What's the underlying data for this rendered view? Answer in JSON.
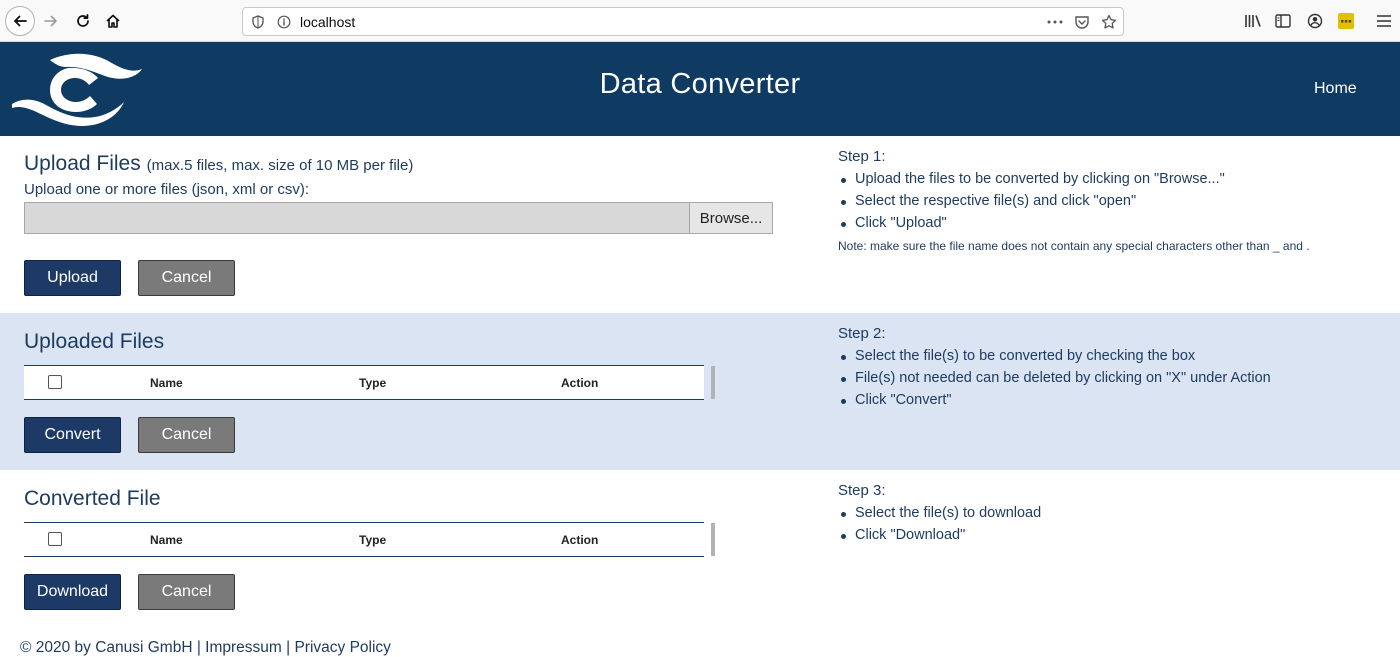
{
  "browser": {
    "url": "localhost",
    "icons": [
      "back-icon",
      "forward-icon",
      "reload-icon",
      "home-icon",
      "shield-icon",
      "info-icon",
      "more-icon",
      "pocket-icon",
      "star-icon",
      "library-icon",
      "sidebar-icon",
      "account-icon",
      "extension-icon",
      "menu-icon"
    ]
  },
  "header": {
    "title": "Data Converter",
    "home_link": "Home",
    "brand_color": "#0f3a62"
  },
  "upload": {
    "title": "Upload Files",
    "title_note": "(max.5 files, max. size of 10 MB per file)",
    "label": "Upload one or more files (json, xml or csv):",
    "browse_label": "Browse...",
    "upload_label": "Upload",
    "cancel_label": "Cancel"
  },
  "uploaded": {
    "title": "Uploaded Files",
    "columns": [
      "Name",
      "Type",
      "Action"
    ],
    "convert_label": "Convert",
    "cancel_label": "Cancel"
  },
  "converted": {
    "title": "Converted File",
    "columns": [
      "Name",
      "Type",
      "Action"
    ],
    "download_label": "Download",
    "cancel_label": "Cancel"
  },
  "steps": [
    {
      "title": "Step 1:",
      "items": [
        "Upload the files to be converted by clicking on \"Browse...\"",
        "Select the respective file(s) and click \"open\"",
        "Click \"Upload\""
      ],
      "note": "Note: make sure the file name does not contain any special characters other than _ and ."
    },
    {
      "title": "Step 2:",
      "items": [
        "Select the file(s) to be converted by checking the box",
        "File(s) not needed can be deleted by clicking on \"X\" under Action",
        "Click \"Convert\""
      ]
    },
    {
      "title": "Step 3:",
      "items": [
        "Select the file(s) to download",
        "Click \"Download\""
      ]
    }
  ],
  "footer": {
    "copyright": "© 2020 by Canusi GmbH",
    "sep": " | ",
    "impressum": "Impressum",
    "privacy": "Privacy Policy"
  }
}
